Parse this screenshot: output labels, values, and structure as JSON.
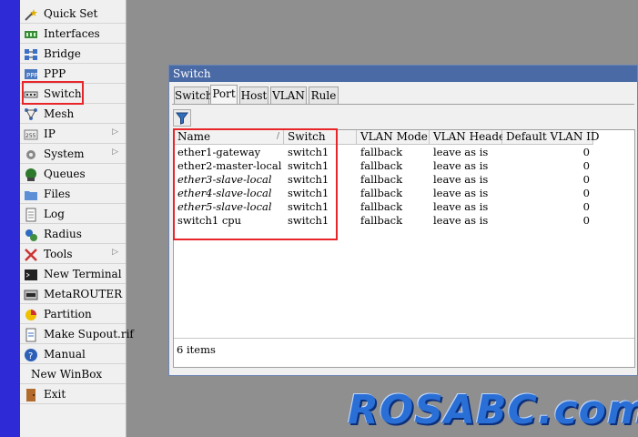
{
  "sidebar": {
    "items": [
      {
        "label": "Quick Set",
        "icon": "magic-wand-icon",
        "submenu": false
      },
      {
        "label": "Interfaces",
        "icon": "network-card-icon",
        "submenu": false
      },
      {
        "label": "Bridge",
        "icon": "bridge-icon",
        "submenu": false
      },
      {
        "label": "PPP",
        "icon": "ppp-icon",
        "submenu": false
      },
      {
        "label": "Switch",
        "icon": "switch-icon",
        "submenu": false,
        "highlighted": true
      },
      {
        "label": "Mesh",
        "icon": "mesh-icon",
        "submenu": false
      },
      {
        "label": "IP",
        "icon": "ip-icon",
        "submenu": true
      },
      {
        "label": "System",
        "icon": "gear-icon",
        "submenu": true
      },
      {
        "label": "Queues",
        "icon": "queues-icon",
        "submenu": false
      },
      {
        "label": "Files",
        "icon": "folder-icon",
        "submenu": false
      },
      {
        "label": "Log",
        "icon": "log-icon",
        "submenu": false
      },
      {
        "label": "Radius",
        "icon": "radius-icon",
        "submenu": false
      },
      {
        "label": "Tools",
        "icon": "tools-icon",
        "submenu": true
      },
      {
        "label": "New Terminal",
        "icon": "terminal-icon",
        "submenu": false
      },
      {
        "label": "MetaROUTER",
        "icon": "metarouter-icon",
        "submenu": false
      },
      {
        "label": "Partition",
        "icon": "partition-icon",
        "submenu": false
      },
      {
        "label": "Make Supout.rif",
        "icon": "supout-file-icon",
        "submenu": false
      },
      {
        "label": "Manual",
        "icon": "help-icon",
        "submenu": false
      },
      {
        "label": "New WinBox",
        "icon": "",
        "submenu": false
      },
      {
        "label": "Exit",
        "icon": "exit-door-icon",
        "submenu": false
      }
    ]
  },
  "window": {
    "title": "Switch",
    "tabs": [
      "Switch",
      "Port",
      "Host",
      "VLAN",
      "Rule"
    ],
    "active_tab": "Port",
    "columns": [
      "Name",
      "Switch",
      "VLAN Mode",
      "VLAN Header",
      "Default VLAN ID"
    ],
    "rows": [
      {
        "name": "ether1-gateway",
        "switch": "switch1",
        "vlan_mode": "fallback",
        "vlan_header": "leave as is",
        "default_vlan_id": "0",
        "italic": false
      },
      {
        "name": "ether2-master-local",
        "switch": "switch1",
        "vlan_mode": "fallback",
        "vlan_header": "leave as is",
        "default_vlan_id": "0",
        "italic": false
      },
      {
        "name": "ether3-slave-local",
        "switch": "switch1",
        "vlan_mode": "fallback",
        "vlan_header": "leave as is",
        "default_vlan_id": "0",
        "italic": true
      },
      {
        "name": "ether4-slave-local",
        "switch": "switch1",
        "vlan_mode": "fallback",
        "vlan_header": "leave as is",
        "default_vlan_id": "0",
        "italic": true
      },
      {
        "name": "ether5-slave-local",
        "switch": "switch1",
        "vlan_mode": "fallback",
        "vlan_header": "leave as is",
        "default_vlan_id": "0",
        "italic": true
      },
      {
        "name": "switch1 cpu",
        "switch": "switch1",
        "vlan_mode": "fallback",
        "vlan_header": "leave as is",
        "default_vlan_id": "0",
        "italic": false
      }
    ],
    "status": "6 items"
  },
  "watermark": "ROSABC.com",
  "colors": {
    "left_strip": "#2d2ad6",
    "titlebar": "#4a6aa6",
    "highlight": "#e8262a",
    "watermark": "#2a6fd6"
  }
}
